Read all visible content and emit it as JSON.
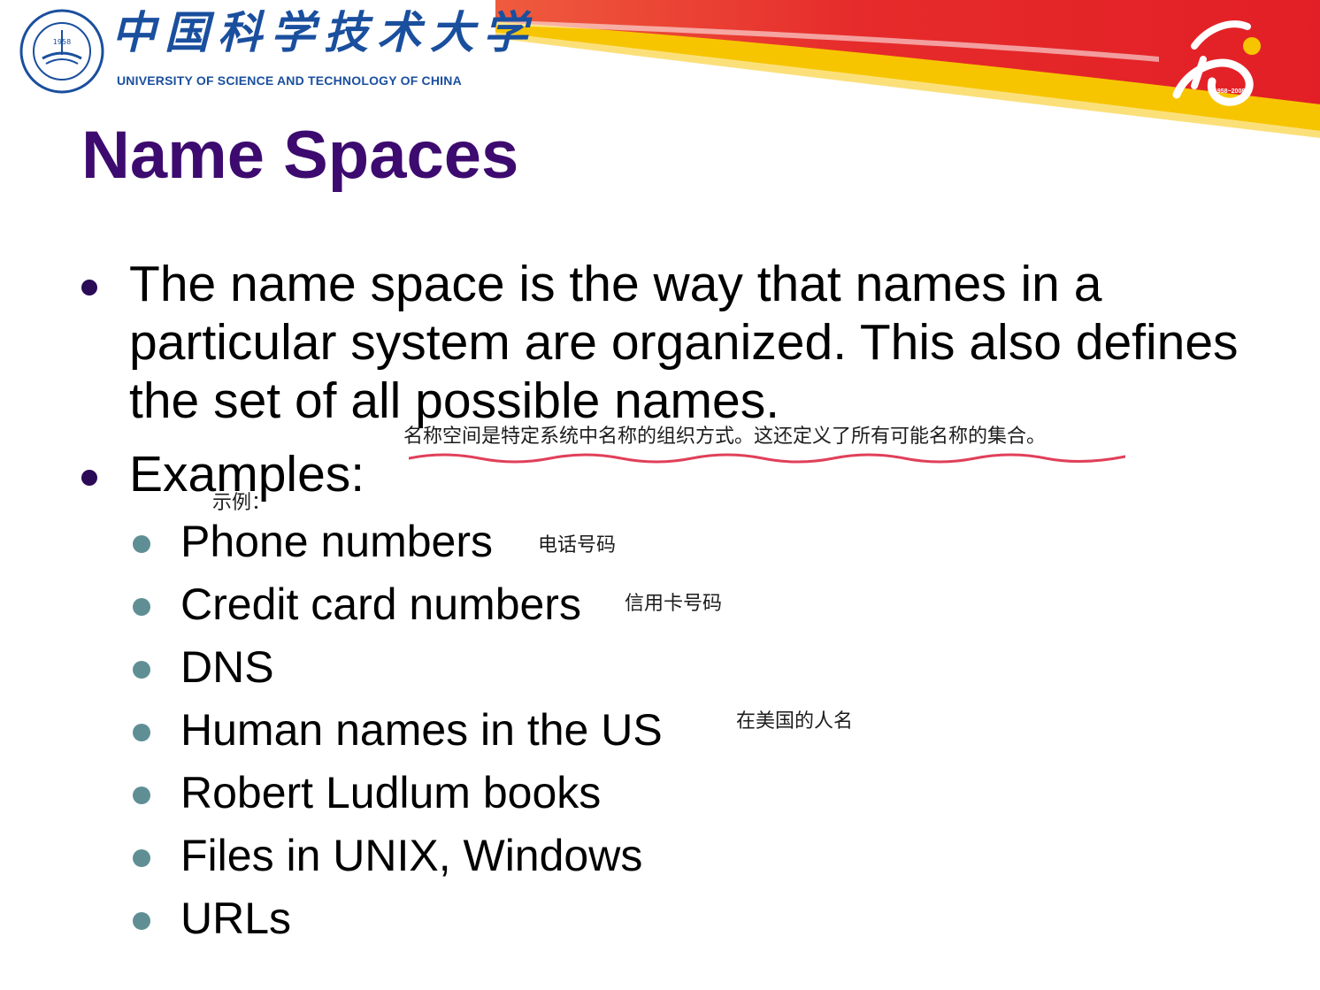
{
  "header": {
    "university_cn": "中国科学技术大学",
    "university_en": "UNIVERSITY OF SCIENCE AND TECHNOLOGY OF CHINA",
    "seal_year": "1958",
    "seal_ring_text": "University of Science and Technology of China",
    "anniversary_years": "1958~2008",
    "colors": {
      "banner_red": "#e32a2a",
      "banner_yellow": "#f6c500",
      "logo_blue": "#1a4f9e"
    }
  },
  "slide": {
    "title": "Name Spaces",
    "title_color": "#3d0b6f",
    "bullets": [
      {
        "text": "The name space is the way that names in a particular system are organized. This also defines the set of all possible names.",
        "annotation": "名称空间是特定系统中名称的组织方式。这还定义了所有可能名称的集合。"
      },
      {
        "text": "Examples:",
        "annotation": "示例："
      }
    ],
    "sub_bullets": [
      {
        "text": "Phone numbers",
        "annotation": "电话号码"
      },
      {
        "text": "Credit card numbers",
        "annotation": "信用卡号码"
      },
      {
        "text": "DNS",
        "annotation": ""
      },
      {
        "text": "Human names in the US",
        "annotation": "在美国的人名"
      },
      {
        "text": "Robert Ludlum books",
        "annotation": ""
      },
      {
        "text": "Files in UNIX, Windows",
        "annotation": ""
      },
      {
        "text": "URLs",
        "annotation": ""
      }
    ]
  }
}
